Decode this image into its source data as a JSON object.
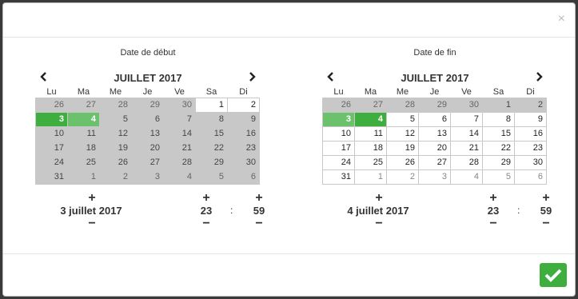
{
  "dialog": {
    "close_glyph": "×"
  },
  "start": {
    "title": "Date de début",
    "month": "JUILLET 2017",
    "weekdays": [
      "Lu",
      "Ma",
      "Me",
      "Je",
      "Ve",
      "Sa",
      "Di"
    ],
    "weeks": [
      [
        "26",
        "27",
        "28",
        "29",
        "30",
        "1",
        "2"
      ],
      [
        "3",
        "4",
        "5",
        "6",
        "7",
        "8",
        "9"
      ],
      [
        "10",
        "11",
        "12",
        "13",
        "14",
        "15",
        "16"
      ],
      [
        "17",
        "18",
        "19",
        "20",
        "21",
        "22",
        "23"
      ],
      [
        "24",
        "25",
        "26",
        "27",
        "28",
        "29",
        "30"
      ],
      [
        "31",
        "1",
        "2",
        "3",
        "4",
        "5",
        "6"
      ]
    ],
    "selected_start": "3",
    "selected_end": "4",
    "date_text": "3 juillet 2017",
    "hour": "23",
    "minute": "59"
  },
  "end": {
    "title": "Date de fin",
    "month": "JUILLET 2017",
    "weekdays": [
      "Lu",
      "Ma",
      "Me",
      "Je",
      "Ve",
      "Sa",
      "Di"
    ],
    "weeks": [
      [
        "26",
        "27",
        "28",
        "29",
        "30",
        "1",
        "2"
      ],
      [
        "3",
        "4",
        "5",
        "6",
        "7",
        "8",
        "9"
      ],
      [
        "10",
        "11",
        "12",
        "13",
        "14",
        "15",
        "16"
      ],
      [
        "17",
        "18",
        "19",
        "20",
        "21",
        "22",
        "23"
      ],
      [
        "24",
        "25",
        "26",
        "27",
        "28",
        "29",
        "30"
      ],
      [
        "31",
        "1",
        "2",
        "3",
        "4",
        "5",
        "6"
      ]
    ],
    "selected_start": "3",
    "selected_end": "4",
    "date_text": "4 juillet 2017",
    "hour": "23",
    "minute": "59"
  },
  "picker_glyphs": {
    "plus": "+",
    "minus": "−",
    "colon": ":"
  },
  "colors": {
    "selected": "#6cc16c",
    "selected_strong": "#3eae3e",
    "disabled": "#c8c8c8",
    "confirm": "#3eae3e"
  }
}
